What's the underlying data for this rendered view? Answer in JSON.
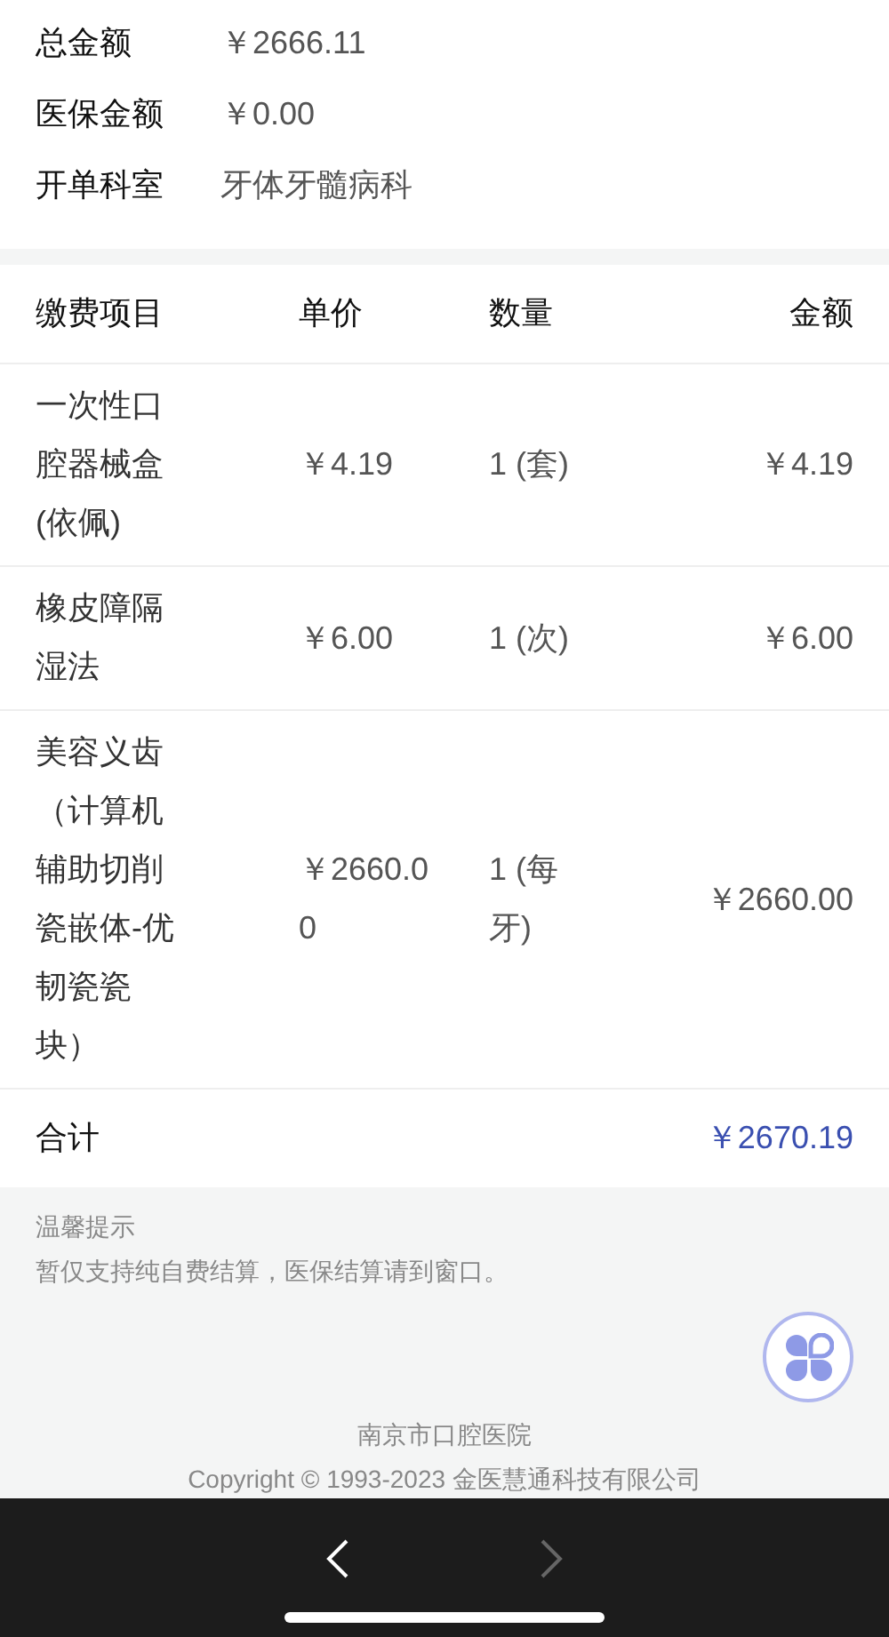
{
  "summary": [
    {
      "label": "总金额",
      "value": "￥2666.11"
    },
    {
      "label": "医保金额",
      "value": "￥0.00"
    },
    {
      "label": "开单科室",
      "value": "牙体牙髓病科"
    }
  ],
  "table": {
    "columns": [
      "缴费项目",
      "单价",
      "数量",
      "金额"
    ],
    "rows": [
      {
        "item": "一次性口腔器械盒(依佩)",
        "price": "￥4.19",
        "qty": "1 (套)",
        "amount": "￥4.19"
      },
      {
        "item": "橡皮障隔湿法",
        "price": "￥6.00",
        "qty": "1 (次)",
        "amount": "￥6.00"
      },
      {
        "item": "美容义齿（计算机辅助切削瓷嵌体-优韧瓷瓷块）",
        "price": "￥2660.00",
        "qty": "1 (每牙)",
        "amount": "￥2660.00"
      }
    ],
    "total": {
      "label": "合计",
      "value": "￥2670.19"
    }
  },
  "notice": {
    "title": "温馨提示",
    "text": "暂仅支持纯自费结算，医保结算请到窗口。"
  },
  "footer": {
    "hospital": "南京市口腔医院",
    "copyright": "Copyright © 1993-2023 金医慧通科技有限公司"
  },
  "nav": {
    "back": {
      "disabled": false
    },
    "forward": {
      "disabled": true
    }
  }
}
